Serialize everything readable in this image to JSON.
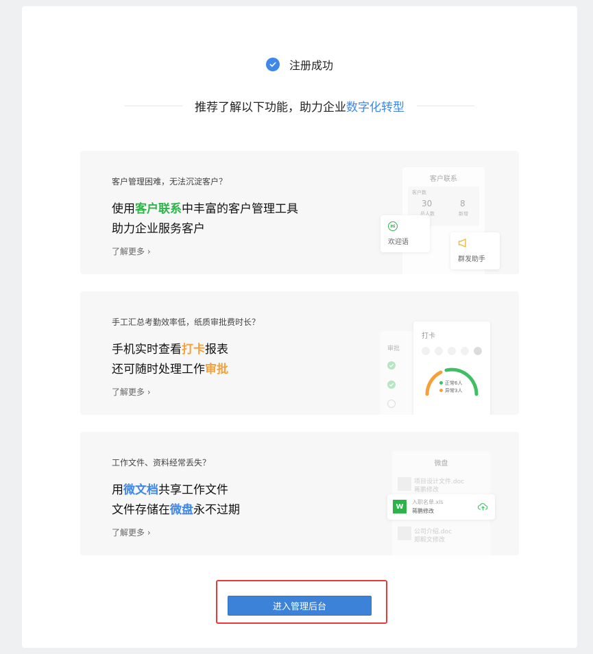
{
  "header": {
    "success_text": "注册成功"
  },
  "subtitle": {
    "prefix": "推荐了解以下功能，助力企业",
    "highlight": "数字化转型"
  },
  "cards": [
    {
      "question": "客户管理困难，无法沉淀客户？",
      "line1_pre": "使用",
      "line1_hl": "客户联系",
      "line1_post": "中丰富的客户管理工具",
      "line2": "助力企业服务客户",
      "more": "了解更多",
      "art": {
        "title": "客户联系",
        "section": "客户数",
        "stat1_value": "30",
        "stat1_label": "总人数",
        "stat2_value": "8",
        "stat2_label": "新增",
        "bubble_icon": "Hi",
        "bubble_text": "欢迎语",
        "group_text": "群发助手"
      }
    },
    {
      "question": "手工汇总考勤效率低，纸质审批费时长？",
      "line1_pre": "手机实时查看",
      "line1_hl": "打卡",
      "line1_post": "报表",
      "line2_pre": "还可随时处理工作",
      "line2_hl": "审批",
      "more": "了解更多",
      "art": {
        "approval_title": "审批",
        "punch_title": "打卡",
        "legend_normal": "正常6人",
        "legend_abnormal": "异常3人",
        "color_normal": "#3fbf63",
        "color_abnormal": "#f6a038"
      }
    },
    {
      "question": "工作文件、资料经常丢失？",
      "line1_pre": "用",
      "line1_hl": "微文档",
      "line1_post": "共享工作文件",
      "line2_pre": "文件存储在",
      "line2_hl": "微盘",
      "line2_post": "永不过期",
      "more": "了解更多",
      "art": {
        "title": "微盘",
        "file1_name": "项目设计文件.doc",
        "file1_sub": "蒋鹏修改",
        "file2_icon": "W",
        "file2_name": "入职名单.xls",
        "file2_sub": "蒋鹏修改",
        "file3_name": "公司介绍.doc",
        "file3_sub": "郑毅文修改"
      }
    }
  ],
  "enter_button": "进入管理后台",
  "colors": {
    "accent": "#3f87e8",
    "green": "#2cb44a",
    "orange": "#f6a038",
    "button": "#3d82d9",
    "highlight_frame": "#e83a3a"
  }
}
